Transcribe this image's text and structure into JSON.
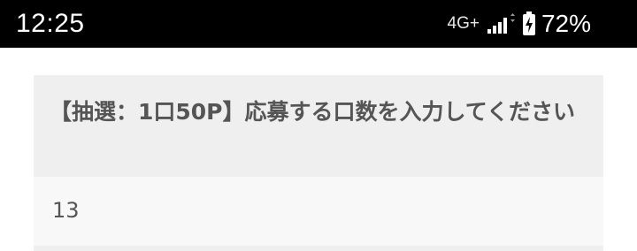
{
  "status_bar": {
    "time": "12:25",
    "network": "4G+",
    "battery_percent": "72%",
    "icons": [
      "signal-icon",
      "battery-charging-icon"
    ]
  },
  "form": {
    "question": "【抽選：1口50P】応募する口数を入力してください",
    "answer": "13"
  },
  "colors": {
    "status_bar_bg": "#000000",
    "header_bg": "#efefef",
    "answer_bg": "#f8f8f8",
    "text": "#555555"
  }
}
